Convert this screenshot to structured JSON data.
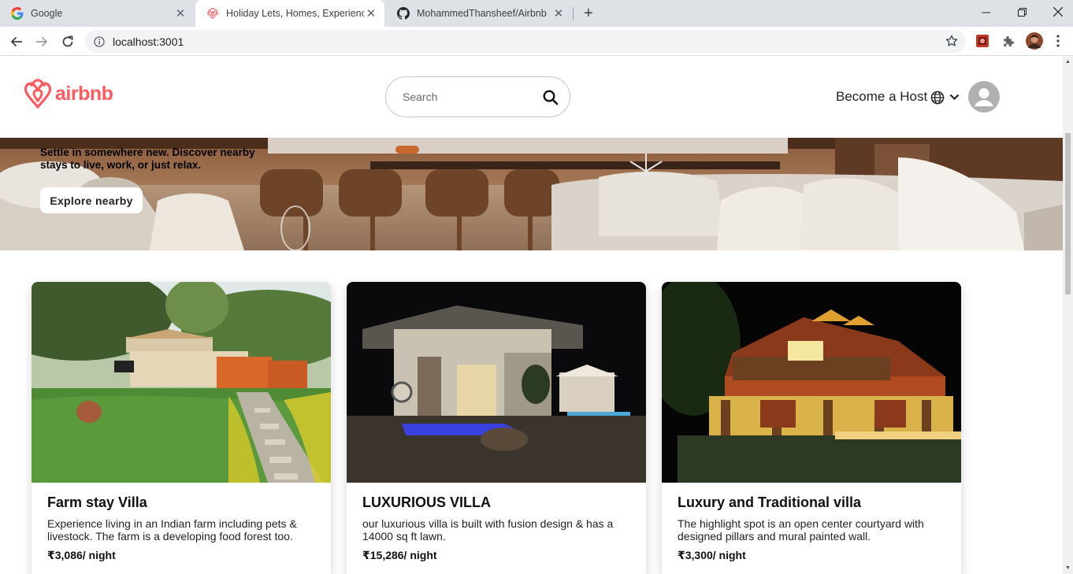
{
  "browser": {
    "tabs": [
      {
        "title": "Google",
        "favicon": "google-icon"
      },
      {
        "title": "Holiday Lets, Homes, Experience",
        "favicon": "airbnb-icon",
        "active": true
      },
      {
        "title": "MohammedThansheef/Airbnb",
        "favicon": "github-icon"
      }
    ],
    "url": "localhost:3001"
  },
  "header": {
    "logo_text": "airbnb",
    "search_placeholder": "Search",
    "host_label": "Become a Host"
  },
  "hero": {
    "text": "Settle in somewhere new. Discover nearby stays to live, work, or just relax.",
    "button_label": "Explore nearby"
  },
  "cards": [
    {
      "title": "Farm stay Villa",
      "description": "Experience living in an Indian farm including pets & livestock. The farm is a developing food forest too.",
      "price": "₹3,086/ night"
    },
    {
      "title": "LUXURIOUS VILLA",
      "description": "our luxurious villa is built with fusion design & has a 14000 sq ft lawn.",
      "price": "₹15,286/ night"
    },
    {
      "title": "Luxury and Traditional villa",
      "description": "The highlight spot is an open center courtyard with designed pillars and mural painted wall.",
      "price": "₹3,300/ night"
    }
  ],
  "colors": {
    "brand": "#ff5a5f",
    "chrome": "#dee1e6"
  }
}
